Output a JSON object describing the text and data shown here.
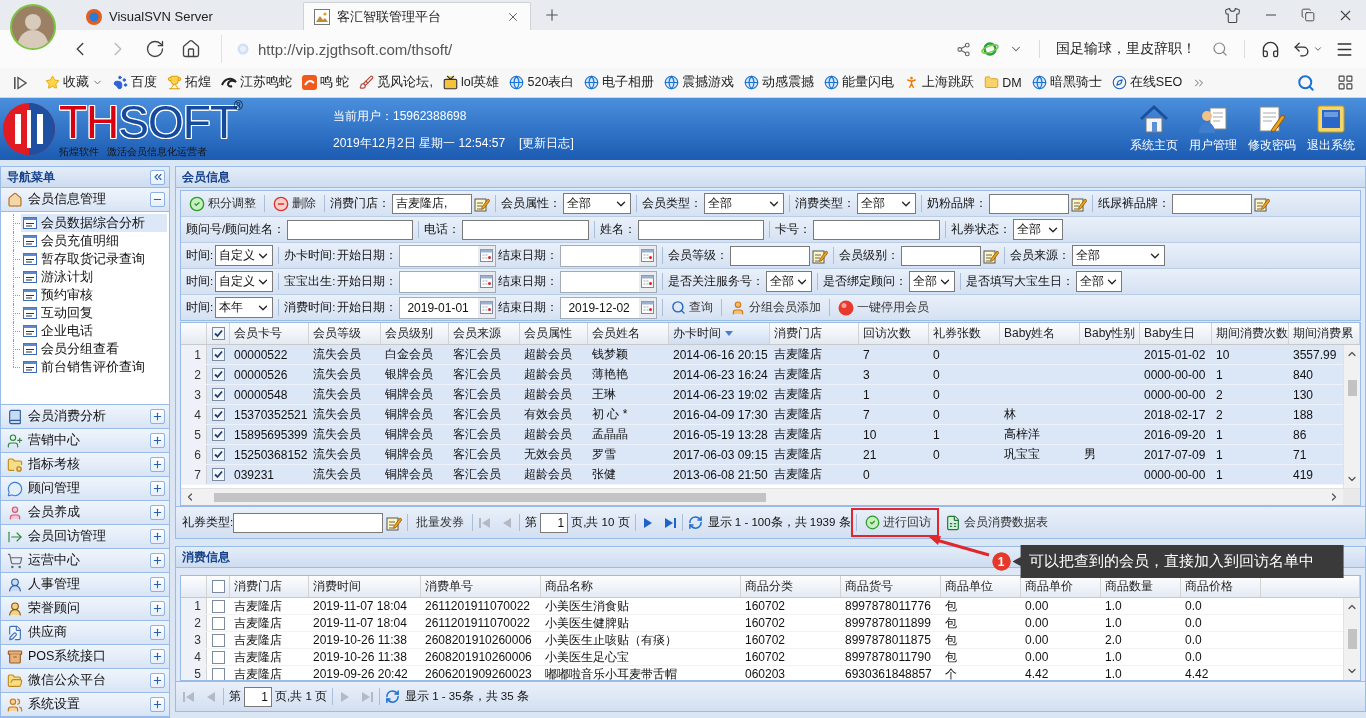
{
  "browser": {
    "tabs": [
      {
        "label": "VisualSVN Server",
        "kind": "svn",
        "selected": false
      },
      {
        "label": "客汇智联管理平台",
        "kind": "app",
        "selected": true
      }
    ],
    "url": "http://vip.zjgthsoft.com/thsoft/",
    "news": "国足输球，里皮辞职！",
    "favorites": "收藏",
    "bookmarks": [
      {
        "label": "百度",
        "kind": "paw"
      },
      {
        "label": "拓煌",
        "kind": "trophy"
      },
      {
        "label": "江苏鸣蛇",
        "kind": "swirl"
      },
      {
        "label": "鸣 蛇",
        "kind": "tile"
      },
      {
        "label": "觅风论坛,",
        "kind": "brush"
      },
      {
        "label": "lol英雄",
        "kind": "tv"
      },
      {
        "label": "520表白",
        "kind": "globe"
      },
      {
        "label": "电子相册",
        "kind": "globe"
      },
      {
        "label": "震撼游戏",
        "kind": "globe"
      },
      {
        "label": "动感震撼",
        "kind": "globe"
      },
      {
        "label": "能量闪电",
        "kind": "globe"
      },
      {
        "label": "上海跳跃",
        "kind": "runner"
      },
      {
        "label": "DM",
        "kind": "folder"
      },
      {
        "label": "暗黑骑士",
        "kind": "globe"
      },
      {
        "label": "在线SEO",
        "kind": "compass"
      }
    ]
  },
  "app": {
    "logo": {
      "wordmark": [
        "TH",
        "SOFT"
      ],
      "trademark": "®",
      "tagline": "拓煌软件   激活会员信息化运营者"
    },
    "current_user": "当前用户：15962388698",
    "datetime": "2019年12月2日 星期一 12:54:57",
    "changelog": "[更新日志]",
    "header_buttons": [
      {
        "label": "系统主页",
        "kind": "home"
      },
      {
        "label": "用户管理",
        "kind": "users"
      },
      {
        "label": "修改密码",
        "kind": "password"
      },
      {
        "label": "退出系统",
        "kind": "exit"
      }
    ]
  },
  "sidebar": {
    "title": "导航菜单",
    "groups": [
      {
        "label": "会员信息管理",
        "kind": "home",
        "expanded": true,
        "children": [
          {
            "label": "会员数据综合分析",
            "selected": true
          },
          {
            "label": "会员充值明细",
            "selected": false
          },
          {
            "label": "暂存取货记录查询",
            "selected": false
          },
          {
            "label": "游泳计划",
            "selected": false
          },
          {
            "label": "预约审核",
            "selected": false
          },
          {
            "label": "互动回复",
            "selected": false
          },
          {
            "label": "企业电话",
            "selected": false
          },
          {
            "label": "会员分组查看",
            "selected": false
          },
          {
            "label": "前台销售评价查询",
            "selected": false
          }
        ]
      },
      {
        "label": "会员消费分析",
        "kind": "book",
        "expanded": false
      },
      {
        "label": "营销中心",
        "kind": "marketing",
        "expanded": false
      },
      {
        "label": "指标考核",
        "kind": "kpi",
        "expanded": false
      },
      {
        "label": "顾问管理",
        "kind": "advisor",
        "expanded": false
      },
      {
        "label": "会员养成",
        "kind": "member",
        "expanded": false
      },
      {
        "label": "会员回访管理",
        "kind": "visit",
        "expanded": false
      },
      {
        "label": "运营中心",
        "kind": "cart",
        "expanded": false
      },
      {
        "label": "人事管理",
        "kind": "hr",
        "expanded": false
      },
      {
        "label": "荣誉顾问",
        "kind": "honor",
        "expanded": false
      },
      {
        "label": "供应商",
        "kind": "supplier",
        "expanded": false
      },
      {
        "label": "POS系统接口",
        "kind": "pos",
        "expanded": false
      },
      {
        "label": "微信公众平台",
        "kind": "wechat",
        "expanded": false
      },
      {
        "label": "系统设置",
        "kind": "settings",
        "expanded": false
      }
    ]
  },
  "member_panel": {
    "title": "会员信息",
    "filters": [
      [
        [
          {
            "kind": "confirm",
            "label": "积分调整"
          }
        ],
        [
          {
            "kind": "delete",
            "label": "删除"
          }
        ],
        [
          {
            "kind": "pick",
            "label": "消费门店：",
            "value": "吉麦隆店,"
          }
        ],
        [
          {
            "kind": "select",
            "label": "会员属性：",
            "value": "全部"
          }
        ],
        [
          {
            "kind": "select",
            "label": "会员类型：",
            "value": "全部"
          }
        ],
        [
          {
            "kind": "select",
            "label": "消费类型：",
            "value": "全部"
          }
        ],
        [
          {
            "kind": "pick",
            "label": "奶粉品牌："
          }
        ],
        [
          {
            "kind": "pick",
            "label": "纸尿裤品牌："
          }
        ]
      ],
      [
        [
          {
            "kind": "text",
            "label": "顾问号/顾问姓名："
          }
        ],
        [
          {
            "kind": "text",
            "label": "电话："
          }
        ],
        [
          {
            "kind": "text",
            "label": "姓名："
          }
        ],
        [
          {
            "kind": "text",
            "label": "卡号："
          }
        ],
        [
          {
            "kind": "select",
            "label": "礼券状态：",
            "value": "全部"
          }
        ]
      ],
      [
        [
          {
            "kind": "select",
            "label": "时间:",
            "value": "自定义"
          }
        ],
        [
          {
            "kind": "label",
            "label": "办卡时间:"
          },
          {
            "kind": "date",
            "label": "开始日期："
          },
          {
            "kind": "date",
            "label": "结束日期："
          }
        ],
        [
          {
            "kind": "pick",
            "label": "会员等级："
          }
        ],
        [
          {
            "kind": "pick",
            "label": "会员级别："
          }
        ],
        [
          {
            "kind": "select",
            "label": "会员来源：",
            "value": "全部"
          }
        ]
      ],
      [
        [
          {
            "kind": "select",
            "label": "时间:",
            "value": "自定义"
          }
        ],
        [
          {
            "kind": "label",
            "label": "宝宝出生:"
          },
          {
            "kind": "date",
            "label": "开始日期："
          },
          {
            "kind": "date",
            "label": "结束日期："
          }
        ],
        [
          {
            "kind": "select",
            "label": "是否关注服务号：",
            "value": "全部"
          }
        ],
        [
          {
            "kind": "select",
            "label": "是否绑定顾问：",
            "value": "全部"
          }
        ],
        [
          {
            "kind": "select",
            "label": "是否填写大宝生日：",
            "value": "全部"
          }
        ]
      ],
      [
        [
          {
            "kind": "select",
            "label": "时间:",
            "value": "本年"
          }
        ],
        [
          {
            "kind": "label",
            "label": "消费时间:"
          },
          {
            "kind": "date",
            "label": "开始日期：",
            "value": "2019-01-01"
          },
          {
            "kind": "date",
            "label": "结束日期：",
            "value": "2019-12-02"
          }
        ],
        [
          {
            "kind": "search",
            "label": "查询"
          }
        ],
        [
          {
            "kind": "group",
            "label": "分组会员添加"
          }
        ],
        [
          {
            "kind": "stop",
            "label": "一键停用会员"
          }
        ]
      ]
    ],
    "grid": {
      "all_checked": true,
      "columns": [
        {
          "label": "会员卡号",
          "sorted": false
        },
        {
          "label": "会员等级",
          "sorted": false
        },
        {
          "label": "会员级别",
          "sorted": false
        },
        {
          "label": "会员来源",
          "sorted": false
        },
        {
          "label": "会员属性",
          "sorted": false
        },
        {
          "label": "会员姓名",
          "sorted": false
        },
        {
          "label": "办卡时间",
          "sorted": true
        },
        {
          "label": "消费门店",
          "sorted": false
        },
        {
          "label": "回访次数",
          "sorted": false
        },
        {
          "label": "礼券张数",
          "sorted": false
        },
        {
          "label": "Baby姓名",
          "sorted": false
        },
        {
          "label": "Baby性别",
          "sorted": false
        },
        {
          "label": "Baby生日",
          "sorted": false
        },
        {
          "label": "期间消费次数",
          "sorted": false
        },
        {
          "label": "期间消费累",
          "sorted": false
        }
      ],
      "rows": [
        {
          "number": "1",
          "checked": true,
          "cells": [
            "00000522",
            "流失会员",
            "白金会员",
            "客汇会员",
            "超龄会员",
            "钱梦颖",
            "2014-06-16 20:15",
            "吉麦隆店",
            "7",
            "0",
            null,
            null,
            "2015-01-02",
            "10",
            "3557.99"
          ]
        },
        {
          "number": "2",
          "checked": true,
          "cells": [
            "00000526",
            "流失会员",
            "银牌会员",
            "客汇会员",
            "超龄会员",
            "薄艳艳",
            "2014-06-23 16:24",
            "吉麦隆店",
            "3",
            "0",
            null,
            null,
            "0000-00-00",
            "1",
            "840"
          ]
        },
        {
          "number": "3",
          "checked": true,
          "cells": [
            "00000548",
            "流失会员",
            "铜牌会员",
            "客汇会员",
            "超龄会员",
            "王琳",
            "2014-06-23 19:02",
            "吉麦隆店",
            "1",
            "0",
            null,
            null,
            "0000-00-00",
            "2",
            "130"
          ]
        },
        {
          "number": "4",
          "checked": true,
          "cells": [
            "15370352521",
            "流失会员",
            "铜牌会员",
            "客汇会员",
            "有效会员",
            "初 心 *",
            "2016-04-09 17:30",
            "吉麦隆店",
            "7",
            "0",
            "林",
            null,
            "2018-02-17",
            "2",
            "188"
          ]
        },
        {
          "number": "5",
          "checked": true,
          "cells": [
            "15895695399",
            "流失会员",
            "铜牌会员",
            "客汇会员",
            "超龄会员",
            "孟晶晶",
            "2016-05-19 13:28",
            "吉麦隆店",
            "10",
            "1",
            "高梓洋",
            null,
            "2016-09-20",
            "1",
            "86"
          ]
        },
        {
          "number": "6",
          "checked": true,
          "cells": [
            "15250368152",
            "流失会员",
            "铜牌会员",
            "客汇会员",
            "无效会员",
            "罗雪",
            "2017-06-03 09:15",
            "吉麦隆店",
            "21",
            "0",
            "巩宝宝",
            "男",
            "2017-07-09",
            "1",
            "71"
          ]
        },
        {
          "number": "7",
          "checked": true,
          "cells": [
            "039231",
            "流失会员",
            "铜牌会员",
            "客汇会员",
            "超龄会员",
            "张健",
            "2013-06-08 21:50",
            "吉麦隆店",
            "0",
            null,
            null,
            null,
            "0000-00-00",
            "1",
            "419"
          ]
        }
      ]
    },
    "toolbar": {
      "coupon_label": "礼券类型:",
      "issue_button": "批量发券",
      "back_nav": [
        {
          "kind": "first",
          "disabled": true
        },
        {
          "kind": "prev",
          "disabled": true
        }
      ],
      "page_prefix": "第",
      "page": "1",
      "page_suffix": "页,共 10 页",
      "forward_nav": [
        {
          "kind": "next",
          "disabled": false
        },
        {
          "kind": "last",
          "disabled": false
        }
      ],
      "summary": "显示 1 - 100条，共 1939 条",
      "visit_button": "进行回访",
      "export_button": "会员消费数据表"
    }
  },
  "annotation": {
    "number": "1",
    "text": "可以把查到的会员，直接加入到回访名单中"
  },
  "consumption_panel": {
    "title": "消费信息",
    "grid": {
      "all_checked": false,
      "columns": [
        "消费门店",
        "消费时间",
        "消费单号",
        "商品名称",
        "商品分类",
        "商品货号",
        "商品单位",
        "商品单价",
        "商品数量",
        "商品价格"
      ],
      "rows": [
        {
          "number": "1",
          "checked": false,
          "cells": [
            "吉麦隆店",
            "2019-11-07 18:04",
            "2611201911070022",
            "小美医生消食贴",
            "160702",
            "8997878011776",
            "包",
            "0.00",
            "1.0",
            "0.0"
          ]
        },
        {
          "number": "2",
          "checked": false,
          "cells": [
            "吉麦隆店",
            "2019-11-07 18:04",
            "2611201911070022",
            "小美医生健脾贴",
            "160702",
            "8997878011899",
            "包",
            "0.00",
            "1.0",
            "0.0"
          ]
        },
        {
          "number": "3",
          "checked": false,
          "cells": [
            "吉麦隆店",
            "2019-10-26 11:38",
            "2608201910260006",
            "小美医生止咳贴（有痰）",
            "160702",
            "8997878011875",
            "包",
            "0.00",
            "2.0",
            "0.0"
          ]
        },
        {
          "number": "4",
          "checked": false,
          "cells": [
            "吉麦隆店",
            "2019-10-26 11:38",
            "2608201910260006",
            "小美医生足心宝",
            "160702",
            "8997878011790",
            "包",
            "0.00",
            "1.0",
            "0.0"
          ]
        },
        {
          "number": "5",
          "checked": false,
          "cells": [
            "吉麦隆店",
            "2019-09-26 20:42",
            "2606201909260023",
            "嘟嘟啦音乐小耳麦带舌帽",
            "060203",
            "6930361848857",
            "个",
            "4.42",
            "1.0",
            "4.42"
          ]
        }
      ]
    },
    "pager": {
      "back_nav": [
        {
          "kind": "first",
          "disabled": true
        },
        {
          "kind": "prev",
          "disabled": true
        }
      ],
      "page_prefix": "第",
      "page": "1",
      "page_suffix": "页,共 1 页",
      "forward_nav": [
        {
          "kind": "next",
          "disabled": true
        },
        {
          "kind": "last",
          "disabled": true
        }
      ],
      "summary": "显示 1 - 35条，共 35 条"
    }
  }
}
